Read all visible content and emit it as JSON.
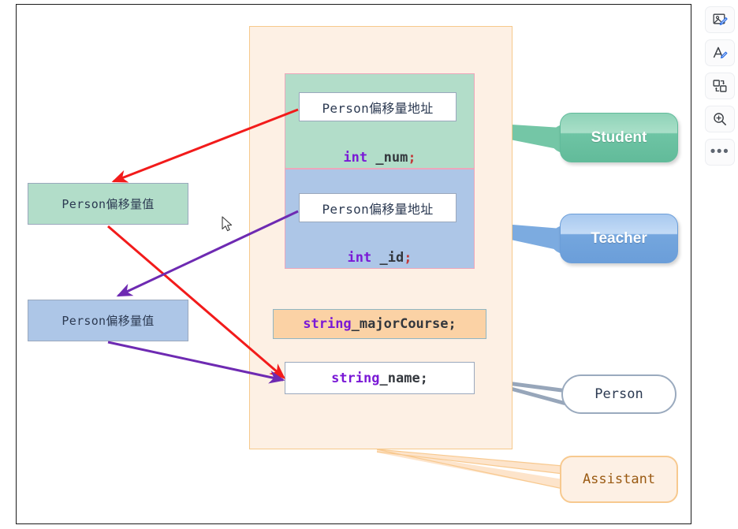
{
  "canvas": {
    "container_label": "class-layout-container"
  },
  "members": {
    "student_panel": {
      "addr_chip": "Person偏移量地址",
      "field_type": "int",
      "field_name": " _num",
      "field_semi": ";"
    },
    "teacher_panel": {
      "addr_chip": "Person偏移量地址",
      "field_type": "int",
      "field_name": " _id",
      "field_semi": ";"
    },
    "major_course": {
      "type": "string",
      "name": " _majorCourse;"
    },
    "name_field": {
      "type": "string",
      "name": " _name;"
    }
  },
  "offsets": {
    "green_box": "Person偏移量值",
    "blue_box": "Person偏移量值"
  },
  "nodes": {
    "student": "Student",
    "teacher": "Teacher",
    "person": "Person",
    "assistant": "Assistant"
  },
  "colors": {
    "container_bg": "#fdf0e4",
    "container_border": "#f6c98b",
    "student_green": "#b2ddc9",
    "teacher_blue": "#adc6e7",
    "panel_border": "#eda7bb",
    "major_course_bg": "#fbd2a5",
    "red_arrow": "#f21b1b",
    "purple_arrow": "#6e2ab2",
    "person_connector": "#97a6ba",
    "assistant_connector": "#f8c98f",
    "keyword_purple": "#7a19d6",
    "semicolon_red": "#c23a3a"
  },
  "toolbar": {
    "items": [
      {
        "name": "image-edit-icon",
        "label": "Edit image"
      },
      {
        "name": "text-edit-icon",
        "label": "Edit text"
      },
      {
        "name": "shape-swap-icon",
        "label": "Replace shape"
      },
      {
        "name": "zoom-in-icon",
        "label": "Zoom in"
      },
      {
        "name": "more-options-icon",
        "label": "More"
      }
    ],
    "more_glyph": "•••"
  }
}
